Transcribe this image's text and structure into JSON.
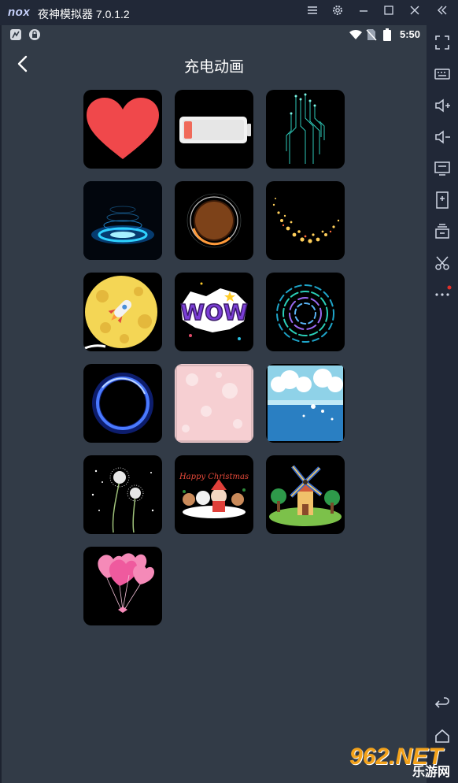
{
  "emulator": {
    "logo": "nox",
    "title": "夜神模拟器 7.0.1.2",
    "controls": [
      "menu-icon",
      "settings-icon",
      "minimize-icon",
      "maximize-icon",
      "collapse-icon"
    ],
    "sidebar_tools": [
      "fullscreen-icon",
      "keyboard-icon",
      "volume-up-icon",
      "volume-down-icon",
      "screen-icon",
      "apk-install-icon",
      "multi-instance-icon",
      "screenshot-icon",
      "more-icon",
      "back-icon",
      "home-icon"
    ]
  },
  "status_bar": {
    "time": "5:50",
    "icons": [
      "app-notification-icon",
      "lock-notification-icon",
      "wifi-icon",
      "no-sim-icon",
      "battery-icon"
    ]
  },
  "page": {
    "title": "充电动画",
    "back_icon": "arrow-left-icon"
  },
  "animations": [
    {
      "name": "heart"
    },
    {
      "name": "battery"
    },
    {
      "name": "circuit"
    },
    {
      "name": "portal"
    },
    {
      "name": "ring-glow"
    },
    {
      "name": "sparkle-trail"
    },
    {
      "name": "moon-rocket"
    },
    {
      "name": "wow-sticker"
    },
    {
      "name": "spiral-rings"
    },
    {
      "name": "blue-ring"
    },
    {
      "name": "pink-bokeh"
    },
    {
      "name": "sea-clouds"
    },
    {
      "name": "dandelion"
    },
    {
      "name": "christmas",
      "text": "Happy Christmas"
    },
    {
      "name": "windmill"
    },
    {
      "name": "balloons"
    }
  ],
  "watermark": {
    "main": "962.NET",
    "sub": "乐游网"
  },
  "colors": {
    "screen_bg": "#323b47",
    "frame_bg": "#212837",
    "accent": "#f3a21b"
  }
}
